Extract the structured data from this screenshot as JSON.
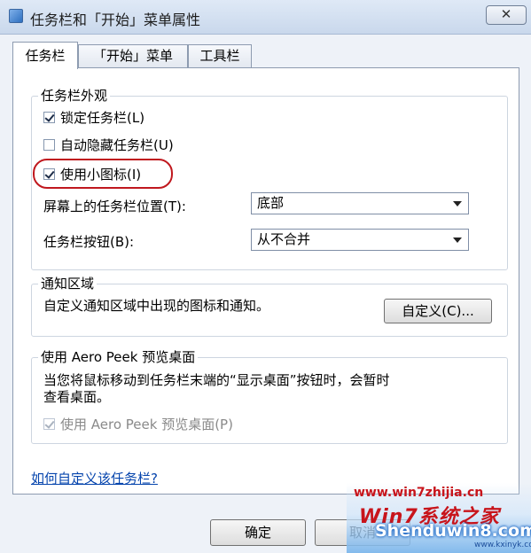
{
  "window": {
    "title": "任务栏和「开始」菜单属性",
    "close_label": "✕"
  },
  "tabs": [
    {
      "label": "任务栏",
      "active": true
    },
    {
      "label": "「开始」菜单",
      "active": false
    },
    {
      "label": "工具栏",
      "active": false
    }
  ],
  "appearance": {
    "group_label": "任务栏外观",
    "checkboxes": [
      {
        "label": "锁定任务栏(L)",
        "checked": true
      },
      {
        "label": "自动隐藏任务栏(U)",
        "checked": false
      },
      {
        "label": "使用小图标(I)",
        "checked": true
      }
    ],
    "position_label": "屏幕上的任务栏位置(T):",
    "position_value": "底部",
    "buttons_label": "任务栏按钮(B):",
    "buttons_value": "从不合并"
  },
  "notification": {
    "group_label": "通知区域",
    "description": "自定义通知区域中出现的图标和通知。",
    "customize_label": "自定义(C)..."
  },
  "aero_peek": {
    "group_label": "使用 Aero Peek 预览桌面",
    "description_line1": "当您将鼠标移动到任务栏末端的“显示桌面”按钮时，会暂时",
    "description_line2": "查看桌面。",
    "checkbox_label": "使用 Aero Peek 预览桌面(P)",
    "checkbox_checked": true,
    "checkbox_disabled": true
  },
  "help_link": "如何自定义该任务栏?",
  "footer": {
    "ok_label": "确定",
    "cancel_label": "取消"
  },
  "watermark": {
    "url": "www.win7zhijia.cn",
    "logo": "Win7系统之家",
    "site": "Shenduwin8.com",
    "sub": "www.kxinyk.com"
  },
  "colors": {
    "highlight_ring": "#c0181e",
    "link": "#0645ad",
    "watermark_red": "#c8141b"
  }
}
